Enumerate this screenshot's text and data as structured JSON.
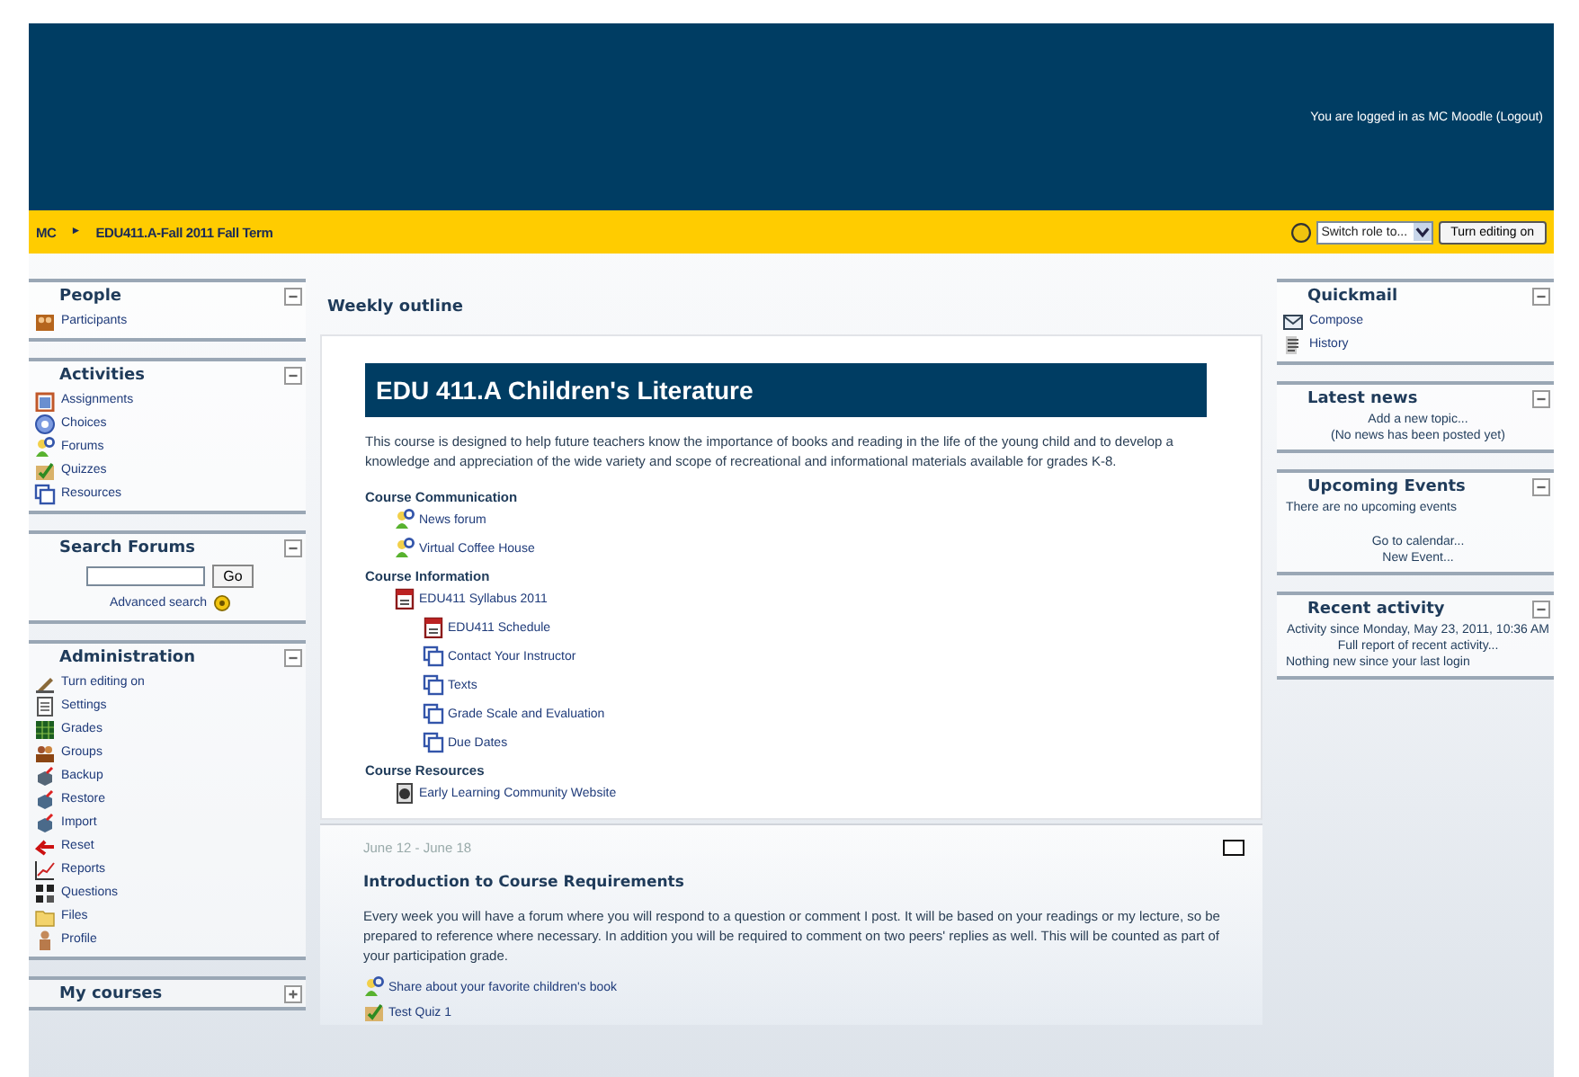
{
  "header": {
    "login_text": "You are logged in as MC Moodle (Logout)"
  },
  "navbar": {
    "breadcrumb": [
      "MC",
      "EDU411.A-Fall 2011 Fall Term"
    ],
    "separator": "►",
    "role_select": "Switch role to...",
    "edit_button": "Turn editing on"
  },
  "left_blocks": [
    {
      "kind": "list",
      "title": "People",
      "expanded": true,
      "items": [
        {
          "kind": "participants",
          "label": "Participants"
        }
      ]
    },
    {
      "kind": "list",
      "title": "Activities",
      "expanded": true,
      "items": [
        {
          "kind": "assignment",
          "label": "Assignments"
        },
        {
          "kind": "choice",
          "label": "Choices"
        },
        {
          "kind": "forum",
          "label": "Forums"
        },
        {
          "kind": "quiz",
          "label": "Quizzes"
        },
        {
          "kind": "resource",
          "label": "Resources"
        }
      ]
    },
    {
      "kind": "search",
      "title": "Search Forums",
      "expanded": true,
      "button": "Go",
      "link": "Advanced search"
    },
    {
      "kind": "list",
      "title": "Administration",
      "expanded": true,
      "items": [
        {
          "kind": "edit",
          "label": "Turn editing on"
        },
        {
          "kind": "settings",
          "label": "Settings"
        },
        {
          "kind": "grades",
          "label": "Grades"
        },
        {
          "kind": "groups",
          "label": "Groups"
        },
        {
          "kind": "backup",
          "label": "Backup"
        },
        {
          "kind": "restore",
          "label": "Restore"
        },
        {
          "kind": "import",
          "label": "Import"
        },
        {
          "kind": "reset",
          "label": "Reset"
        },
        {
          "kind": "reports",
          "label": "Reports"
        },
        {
          "kind": "questions",
          "label": "Questions"
        },
        {
          "kind": "files",
          "label": "Files"
        },
        {
          "kind": "profile",
          "label": "Profile"
        }
      ]
    },
    {
      "kind": "list",
      "title": "My courses",
      "expanded": false
    }
  ],
  "center": {
    "heading": "Weekly outline",
    "course": {
      "title": "EDU 411.A Children's Literature",
      "description": "This course is designed to help future teachers know the importance of books and reading in the life of the young child and to develop a knowledge and appreciation of the wide variety and scope of recreational and informational materials available for grades K-8.",
      "sections": [
        {
          "title": "Course Communication",
          "items": [
            {
              "kind": "forum",
              "label": "News forum"
            },
            {
              "kind": "forum",
              "label": "Virtual Coffee House"
            }
          ]
        },
        {
          "title": "Course Information",
          "items": [
            {
              "kind": "pdf",
              "label": "EDU411 Syllabus 2011",
              "children": [
                {
                  "kind": "pdf",
                  "label": "EDU411 Schedule"
                },
                {
                  "kind": "page",
                  "label": "Contact Your Instructor"
                },
                {
                  "kind": "page",
                  "label": "Texts"
                },
                {
                  "kind": "page",
                  "label": "Grade Scale and Evaluation"
                },
                {
                  "kind": "page",
                  "label": "Due Dates"
                }
              ]
            }
          ]
        },
        {
          "title": "Course Resources",
          "items": [
            {
              "kind": "link",
              "label": "Early Learning Community Website"
            }
          ]
        }
      ]
    },
    "week": {
      "dates": "June 12 - June 18",
      "title": "Introduction to Course Requirements",
      "description": "Every week you will have a forum where you will respond to a question or comment I post. It will be based on your readings or my lecture, so be prepared to reference where necessary. In addition you will be required to comment on two peers' replies as well. This will be counted as part of your participation grade.",
      "items": [
        {
          "kind": "forum",
          "label": "Share about your favorite children's book"
        },
        {
          "kind": "quiz",
          "label": "Test Quiz 1"
        }
      ]
    }
  },
  "right_blocks": [
    {
      "kind": "list",
      "title": "Quickmail",
      "expanded": true,
      "items": [
        {
          "kind": "mail",
          "label": "Compose"
        },
        {
          "kind": "history",
          "label": "History"
        }
      ]
    },
    {
      "kind": "text",
      "title": "Latest news",
      "expanded": true,
      "lines": [
        {
          "kind": "link",
          "text": "Add a new topic..."
        },
        {
          "kind": "note",
          "text": "(No news has been posted yet)"
        }
      ]
    },
    {
      "kind": "text",
      "title": "Upcoming Events",
      "expanded": true,
      "lines": [
        {
          "kind": "plain",
          "text": "There are no upcoming events"
        },
        {
          "kind": "gap",
          "text": "Go to calendar..."
        },
        {
          "kind": "link",
          "text": "New Event..."
        }
      ]
    },
    {
      "kind": "text",
      "title": "Recent activity",
      "expanded": true,
      "lines": [
        {
          "kind": "link",
          "text": "Activity since Monday, May 23, 2011, 10:36 AM"
        },
        {
          "kind": "link",
          "text": "Full report of recent activity..."
        },
        {
          "kind": "plain",
          "text": "Nothing new since your last login"
        }
      ]
    }
  ]
}
